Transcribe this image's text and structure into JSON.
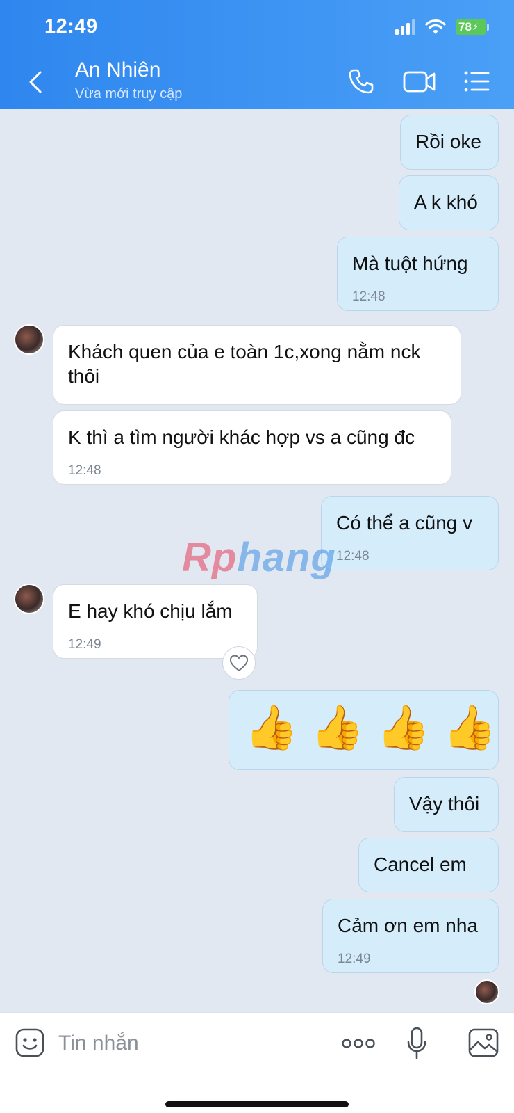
{
  "status_bar": {
    "time": "12:49",
    "battery": "78"
  },
  "header": {
    "contact_name": "An Nhiên",
    "contact_status": "Vừa mới truy cập"
  },
  "messages": [
    {
      "dir": "out",
      "text": "Rồi oke"
    },
    {
      "dir": "out",
      "text": "A k khó"
    },
    {
      "dir": "out",
      "text": "Mà tuột hứng",
      "time": "12:48"
    },
    {
      "dir": "in",
      "text_line1": "Khách quen của e toàn 1c,xong nằm nck",
      "text_line2": "thôi"
    },
    {
      "dir": "in",
      "text": "K thì a tìm người khác hợp vs a cũng đc",
      "time": "12:48"
    },
    {
      "dir": "out",
      "text": "Có thể a cũng v",
      "time": "12:48"
    },
    {
      "dir": "in",
      "text": "E hay khó chịu lắm",
      "time": "12:49"
    },
    {
      "dir": "out",
      "emoji": "👍"
    },
    {
      "dir": "out",
      "text": "Vậy thôi"
    },
    {
      "dir": "out",
      "text": "Cancel em"
    },
    {
      "dir": "out",
      "text": "Cảm ơn em nha",
      "time": "12:49"
    }
  ],
  "watermark": {
    "part1": "Rp",
    "part2": "hang"
  },
  "composer": {
    "placeholder": "Tin nhắn"
  },
  "colors": {
    "header": "#3a93f2",
    "outgoing_bubble": "#d5ecfb",
    "incoming_bubble": "#ffffff",
    "chat_bg": "#e2e8f1"
  }
}
